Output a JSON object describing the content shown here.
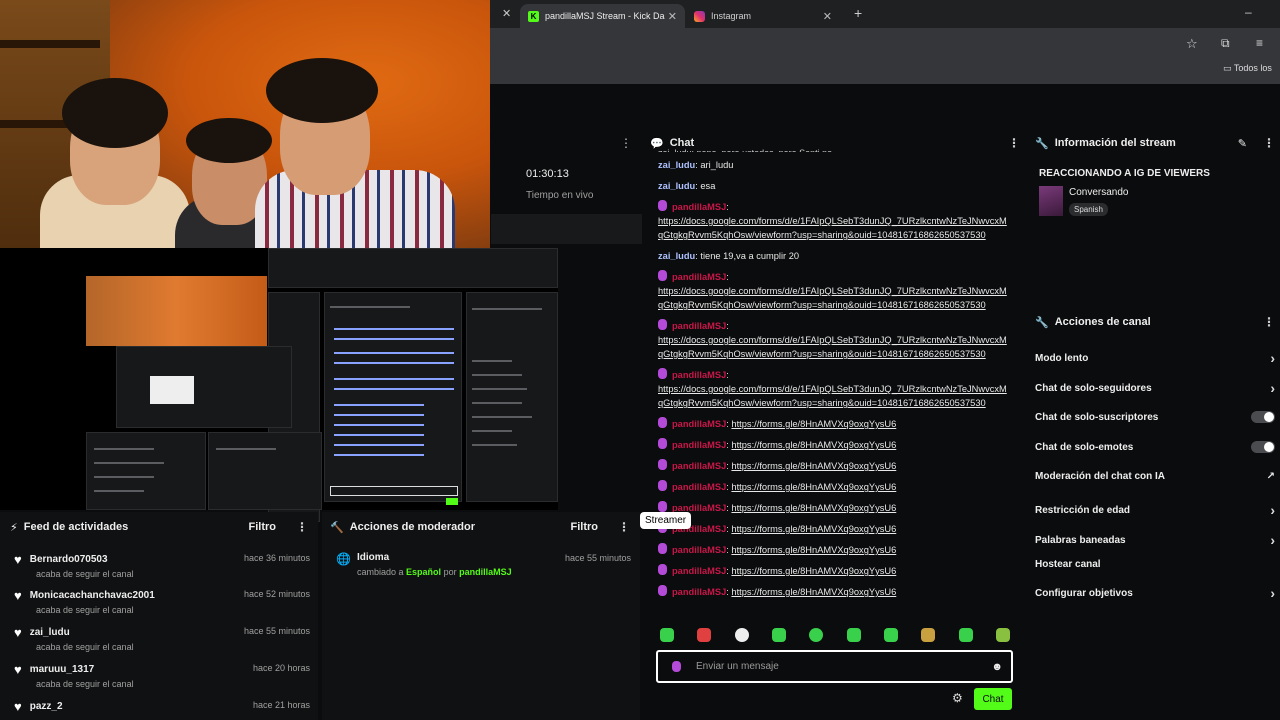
{
  "browser": {
    "tabs": [
      {
        "label": "pandillaMSJ Stream - Kick Dash",
        "active": true
      },
      {
        "label": "Instagram",
        "active": false
      }
    ],
    "bookmark_label": "Todos los"
  },
  "live": {
    "time": "01:30:13",
    "label": "Tiempo en vivo"
  },
  "chat": {
    "title": "Chat",
    "truncated_top": "zai_ludu: nono, pero ustedes, para Santi no",
    "messages": [
      {
        "user": "zai_ludu",
        "text": "ari_ludu",
        "type": "zai"
      },
      {
        "user": "zai_ludu",
        "text": "esa",
        "type": "zai"
      },
      {
        "user": "pandillaMSJ",
        "text": "https://docs.google.com/forms/d/e/1FAIpQLSebT3dunJQ_7URzlkcntwNzTeJNwvcxMqGtgkgRvvm5KqhOsw/viewform?usp=sharing&ouid=104816716862650537530",
        "type": "pan-block"
      },
      {
        "user": "zai_ludu",
        "text": "tiene 19,va a cumplir 20",
        "type": "zai"
      },
      {
        "user": "pandillaMSJ",
        "text": "https://docs.google.com/forms/d/e/1FAIpQLSebT3dunJQ_7URzlkcntwNzTeJNwvcxMqGtgkgRvvm5KqhOsw/viewform?usp=sharing&ouid=104816716862650537530",
        "type": "pan-block"
      },
      {
        "user": "pandillaMSJ",
        "text": "https://docs.google.com/forms/d/e/1FAIpQLSebT3dunJQ_7URzlkcntwNzTeJNwvcxMqGtgkgRvvm5KqhOsw/viewform?usp=sharing&ouid=104816716862650537530",
        "type": "pan-block"
      },
      {
        "user": "pandillaMSJ",
        "text": "https://docs.google.com/forms/d/e/1FAIpQLSebT3dunJQ_7URzlkcntwNzTeJNwvcxMqGtgkgRvvm5KqhOsw/viewform?usp=sharing&ouid=104816716862650537530",
        "type": "pan-block"
      },
      {
        "user": "pandillaMSJ",
        "text": "https://forms.gle/8HnAMVXq9oxgYysU6",
        "type": "pan"
      },
      {
        "user": "pandillaMSJ",
        "text": "https://forms.gle/8HnAMVXq9oxgYysU6",
        "type": "pan"
      },
      {
        "user": "pandillaMSJ",
        "text": "https://forms.gle/8HnAMVXq9oxgYysU6",
        "type": "pan"
      },
      {
        "user": "pandillaMSJ",
        "text": "https://forms.gle/8HnAMVXq9oxgYysU6",
        "type": "pan"
      },
      {
        "user": "pandillaMSJ",
        "text": "https://forms.gle/8HnAMVXq9oxgYysU6",
        "type": "pan"
      },
      {
        "user": "pandillaMSJ",
        "text": "https://forms.gle/8HnAMVXq9oxgYysU6",
        "type": "pan"
      },
      {
        "user": "pandillaMSJ",
        "text": "https://forms.gle/8HnAMVXq9oxgYysU6",
        "type": "pan"
      },
      {
        "user": "pandillaMSJ",
        "text": "https://forms.gle/8HnAMVXq9oxgYysU6",
        "type": "pan"
      },
      {
        "user": "pandillaMSJ",
        "text": "https://forms.gle/8HnAMVXq9oxgYysU6",
        "type": "pan"
      }
    ],
    "input_placeholder": "Enviar un mensaje",
    "send_label": "Chat",
    "tooltip": "Streamer"
  },
  "stream_info": {
    "title": "Información del stream",
    "stream_title": "REACCIONANDO A IG DE VIEWERS",
    "category": "Conversando",
    "language": "Spanish"
  },
  "channel_actions": {
    "title": "Acciones de canal",
    "items": [
      {
        "label": "Modo lento",
        "control": "chevron"
      },
      {
        "label": "Chat de solo-seguidores",
        "control": "chevron"
      },
      {
        "label": "Chat de solo-suscriptores",
        "control": "toggle"
      },
      {
        "label": "Chat de solo-emotes",
        "control": "toggle"
      },
      {
        "label": "Moderación del chat con IA",
        "control": "external"
      },
      {
        "label": "Restricción de edad",
        "control": "chevron"
      },
      {
        "label": "Palabras baneadas",
        "control": "chevron"
      },
      {
        "label": "Hostear canal",
        "control": "none"
      },
      {
        "label": "Configurar objetivos",
        "control": "chevron"
      }
    ]
  },
  "activity_feed": {
    "title": "Feed de actividades",
    "filter": "Filtro",
    "items": [
      {
        "user": "Bernardo070503",
        "action": "acaba de seguir el canal",
        "time": "hace 36 minutos"
      },
      {
        "user": "Monicacachanchavac2001",
        "action": "acaba de seguir el canal",
        "time": "hace 52 minutos"
      },
      {
        "user": "zai_ludu",
        "action": "acaba de seguir el canal",
        "time": "hace 55 minutos"
      },
      {
        "user": "maruuu_1317",
        "action": "acaba de seguir el canal",
        "time": "hace 20 horas"
      },
      {
        "user": "pazz_2",
        "action": "",
        "time": "hace 21 horas"
      }
    ]
  },
  "mod_actions": {
    "title": "Acciones de moderador",
    "filter": "Filtro",
    "item": {
      "title": "Idioma",
      "pre": "cambiado a",
      "value": "Español",
      "by": "por",
      "user": "pandillaMSJ",
      "time": "hace 55 minutos"
    }
  }
}
